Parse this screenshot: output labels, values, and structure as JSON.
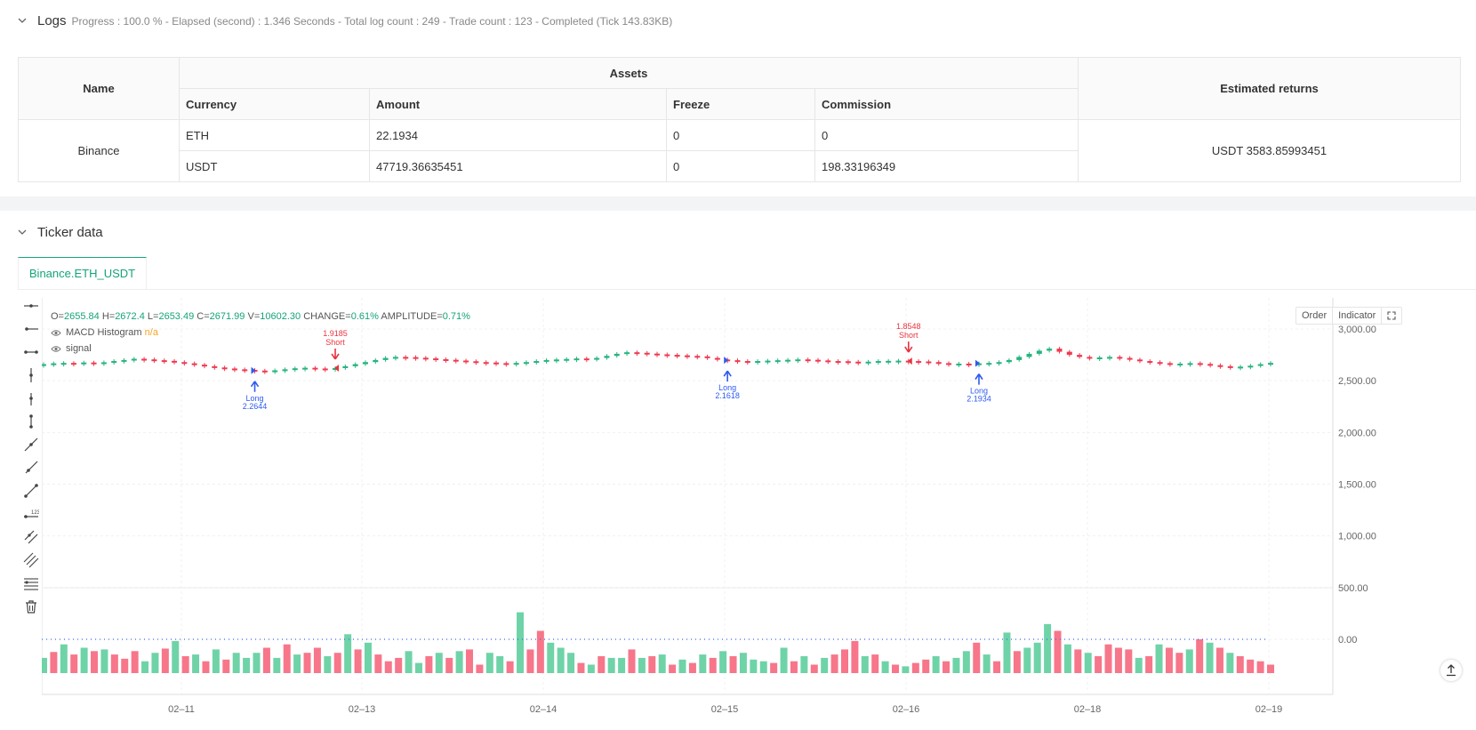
{
  "logs": {
    "title": "Logs",
    "stats": "Progress : 100.0 % - Elapsed (second) : 1.346  Seconds - Total log count : 249 - Trade count : 123 - Completed (Tick 143.83KB)"
  },
  "table": {
    "name_header": "Name",
    "assets_header": "Assets",
    "returns_header": "Estimated returns",
    "columns": [
      "Currency",
      "Amount",
      "Freeze",
      "Commission"
    ],
    "exchange": "Binance",
    "rows": [
      {
        "currency": "ETH",
        "amount": "22.1934",
        "freeze": "0",
        "commission": "0"
      },
      {
        "currency": "USDT",
        "amount": "47719.36635451",
        "freeze": "0",
        "commission": "198.33196349"
      }
    ],
    "estimated_returns": "USDT 3583.85993451"
  },
  "ticker": {
    "title": "Ticker data",
    "tab": "Binance.ETH_USDT",
    "ohlc": {
      "o_label": "O=",
      "o": "2655.84",
      "h_label": "H=",
      "h": "2672.4",
      "l_label": "L=",
      "l": "2653.49",
      "c_label": "C=",
      "c": "2671.99",
      "v_label": "V=",
      "v": "10602.30",
      "change_label": "CHANGE=",
      "change": "0.61%",
      "amp_label": "AMPLITUDE=",
      "amp": "0.71%"
    },
    "macd_label": "MACD Histogram",
    "macd_value": "n/a",
    "signal_label": "signal",
    "buttons": {
      "order": "Order",
      "indicator": "Indicator"
    },
    "toolbar_icons": [
      "horizontal-line-icon",
      "horizontal-ray-icon",
      "horizontal-segment-icon",
      "vertical-line-icon",
      "vertical-ray-icon",
      "vertical-segment-icon",
      "trend-line-icon",
      "ray-line-icon",
      "segment-line-icon",
      "price-label-icon",
      "parallel-channel-icon",
      "multi-channel-icon",
      "fibonacci-icon",
      "trash-icon"
    ]
  },
  "colors": {
    "up": "#26b47f",
    "down": "#f0394f",
    "accent": "#15a37a",
    "long": "#2d5bf0",
    "short": "#e8343f"
  },
  "chart_data": {
    "type": "candlestick",
    "y_ticks": [
      "3,000.00",
      "2,500.00",
      "2,000.00",
      "1,500.00",
      "1,000.00",
      "500.00",
      "0.00"
    ],
    "y_values": [
      3000,
      2500,
      2000,
      1500,
      1000,
      500,
      0
    ],
    "x_ticks": [
      "02–11",
      "02–13",
      "02–14",
      "02–15",
      "02–16",
      "02–18",
      "02–19"
    ],
    "price_series": [
      2660,
      2668,
      2672,
      2670,
      2676,
      2662,
      2678,
      2690,
      2700,
      2712,
      2706,
      2698,
      2692,
      2680,
      2668,
      2655,
      2640,
      2628,
      2618,
      2610,
      2605,
      2598,
      2590,
      2600,
      2610,
      2620,
      2625,
      2618,
      2610,
      2622,
      2640,
      2660,
      2680,
      2700,
      2720,
      2730,
      2728,
      2722,
      2716,
      2708,
      2702,
      2695,
      2688,
      2680,
      2676,
      2670,
      2668,
      2672,
      2680,
      2690,
      2700,
      2705,
      2710,
      2715,
      2712,
      2720,
      2740,
      2760,
      2775,
      2770,
      2762,
      2755,
      2750,
      2745,
      2740,
      2735,
      2720,
      2705,
      2698,
      2690,
      2686,
      2690,
      2694,
      2698,
      2702,
      2706,
      2702,
      2696,
      2690,
      2688,
      2684,
      2680,
      2684,
      2690,
      2692,
      2694,
      2690,
      2686,
      2680,
      2670,
      2660,
      2665,
      2662,
      2668,
      2672,
      2680,
      2700,
      2730,
      2760,
      2790,
      2810,
      2780,
      2750,
      2730,
      2720,
      2725,
      2730,
      2720,
      2705,
      2690,
      2680,
      2670,
      2660,
      2665,
      2670,
      2662,
      2650,
      2640,
      2632,
      2636,
      2645,
      2660,
      2672
    ],
    "volume_bars": [
      18,
      25,
      34,
      22,
      30,
      26,
      28,
      22,
      17,
      26,
      14,
      24,
      29,
      38,
      20,
      22,
      14,
      28,
      16,
      24,
      18,
      24,
      30,
      18,
      34,
      22,
      24,
      30,
      20,
      24,
      46,
      28,
      36,
      22,
      14,
      18,
      26,
      12,
      20,
      24,
      18,
      26,
      28,
      10,
      24,
      20,
      14,
      72,
      28,
      50,
      36,
      30,
      24,
      12,
      10,
      20,
      18,
      18,
      28,
      18,
      20,
      22,
      10,
      16,
      12,
      22,
      18,
      26,
      20,
      24,
      16,
      14,
      12,
      30,
      14,
      20,
      10,
      18,
      22,
      28,
      38,
      20,
      22,
      14,
      10,
      8,
      12,
      16,
      20,
      14,
      18,
      26,
      36,
      22,
      14,
      48,
      26,
      30,
      36,
      58,
      50,
      34,
      28,
      24,
      20,
      34,
      30,
      28,
      18,
      20,
      34,
      30,
      24,
      28,
      40,
      36,
      30,
      24,
      20,
      16,
      14,
      10
    ],
    "volume_colors": "gdgdgdgdddggdgdgdgdgggdgdgddgdgdgdddggdgdgddggdgddgggdgdggdgdgdgdgdgdgggdgdgdgdddgdgdgddgdggdgdgdgggdgdgddddgdgddgdgdg",
    "markers": [
      {
        "type": "long",
        "label": "Long",
        "value": "2.2644",
        "index": 21
      },
      {
        "type": "short",
        "label": "Short",
        "value": "1.9185",
        "index": 29
      },
      {
        "type": "long",
        "label": "Long",
        "value": "2.1618",
        "index": 68
      },
      {
        "type": "short",
        "label": "Short",
        "value": "1.8548",
        "index": 86
      },
      {
        "type": "long",
        "label": "Long",
        "value": "2.1934",
        "index": 93
      }
    ]
  }
}
